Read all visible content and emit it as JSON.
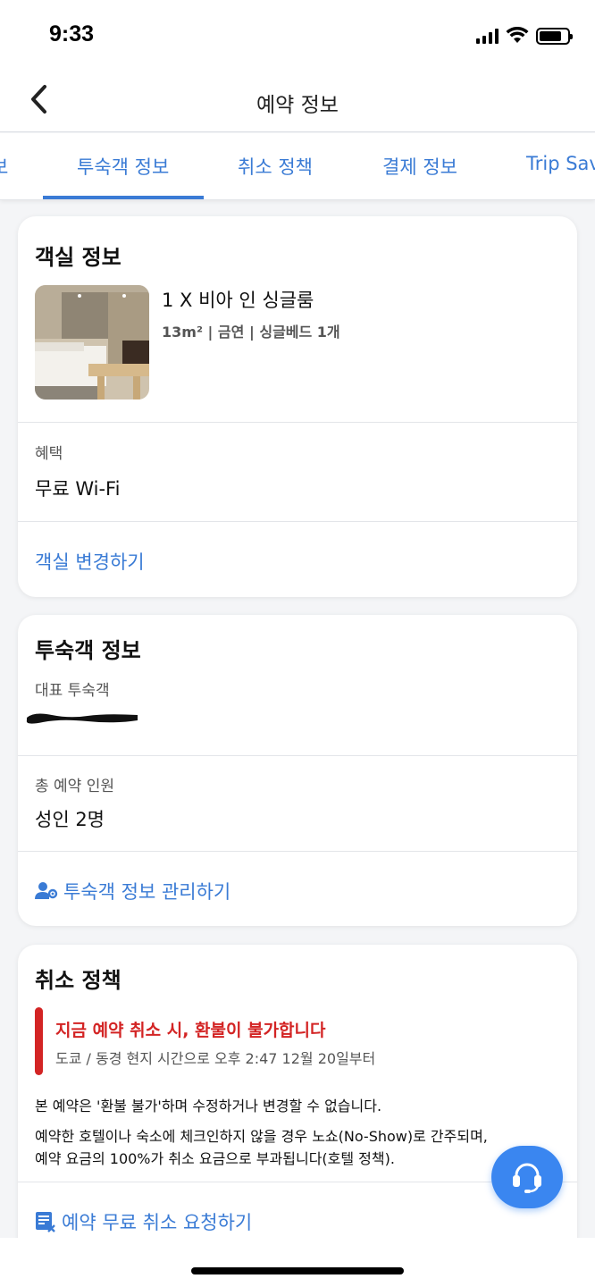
{
  "status_bar": {
    "time": "9:33"
  },
  "header": {
    "title": "예약 정보"
  },
  "tabs": [
    {
      "label": "보"
    },
    {
      "label": "투숙객 정보"
    },
    {
      "label": "취소 정책"
    },
    {
      "label": "결제 정보"
    },
    {
      "label": "Trip Sav"
    }
  ],
  "room_card": {
    "title": "객실 정보",
    "room_name": "1 X 비아 인 싱글룸",
    "room_specs": "13m² | 금연 | 싱글베드 1개",
    "benefit_label": "혜택",
    "benefit_value": "무료 Wi-Fi",
    "change_link": "객실 변경하기"
  },
  "guest_card": {
    "title": "투숙객 정보",
    "main_guest_label": "대표 투숙객",
    "total_label": "총 예약 인원",
    "total_value": "성인 2명",
    "manage_link": "투숙객 정보 관리하기"
  },
  "cancel_card": {
    "title": "취소 정책",
    "warning": "지금 예약 취소 시, 환불이 불가합니다",
    "time_note": "도쿄 / 동경 현지 시간으로 오후 2:47 12월 20일부터",
    "policy_line1": "본 예약은 '환불 불가'하며 수정하거나 변경할 수 없습니다.",
    "policy_line2": "예약한 호텔이나 숙소에 체크인하지 않을 경우 노쇼(No-Show)로 간주되며,",
    "policy_line3": "예약 요금의 100%가 취소 요금으로 부과됩니다(호텔 정책).",
    "request_link": "예약 무료 취소 요청하기"
  },
  "colors": {
    "accent": "#3a7bd5",
    "warning": "#d32424",
    "fab": "#3a86f0"
  },
  "icons": {
    "back": "chevron-left-icon",
    "manage": "user-gear-icon",
    "request": "document-cancel-icon",
    "support": "headset-icon"
  }
}
